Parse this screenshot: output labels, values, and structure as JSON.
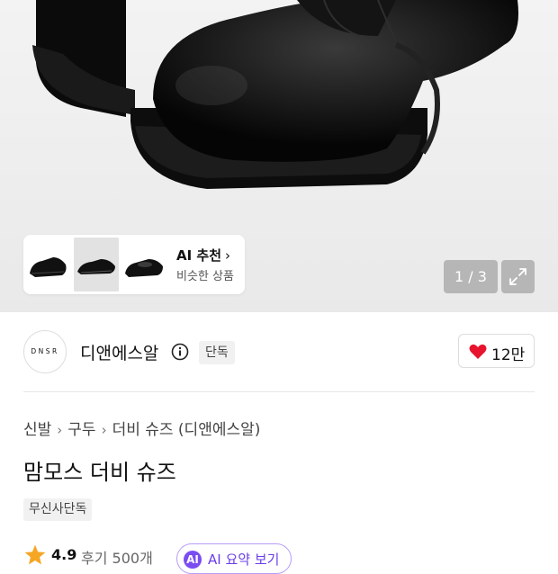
{
  "gallery": {
    "counter": "1 / 3",
    "recommend": {
      "title": "AI 추천",
      "chevron": "›",
      "subtitle": "비슷한 상품"
    }
  },
  "brand": {
    "logo_text": "DNSR",
    "name": "디앤에스알",
    "badge": "단독",
    "likes": "12만"
  },
  "breadcrumb": [
    "신발",
    "구두",
    "더비 슈즈 (디앤에스알)"
  ],
  "breadcrumb_sep": "›",
  "product": {
    "title": "맘모스 더비 슈즈",
    "exclusive_tag": "무신사단독"
  },
  "rating": {
    "score": "4.9",
    "reviews": "후기 500개"
  },
  "ai_summary": {
    "badge": "AI",
    "label": "AI 요약 보기"
  },
  "colors": {
    "heart": "#e8132d",
    "ai_purple": "#7b4cf2",
    "star": "#f5a623"
  }
}
